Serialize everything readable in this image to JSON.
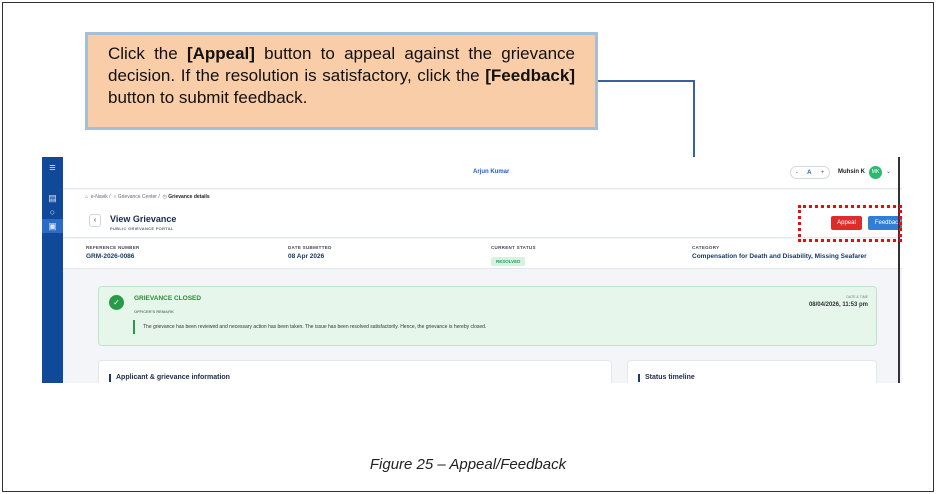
{
  "callout": {
    "part1": "Click the ",
    "appeal_bold": "[Appeal]",
    "part2": " button to appeal against the grievance decision. If the resolution is satisfactory, click the ",
    "feedback_bold": "[Feedback]",
    "part3": " button to submit feedback."
  },
  "topbar": {
    "center_name": "Arjun Kumar",
    "zoom_minus": "-",
    "zoom_a": "A",
    "zoom_plus": "+",
    "user_name": "Muhsin K",
    "avatar_initials": "MK"
  },
  "breadcrumb": {
    "home": "e-Navik",
    "sep1": "/",
    "center": "Grievance Center",
    "sep2": "/",
    "current": "Grievance details"
  },
  "header": {
    "title": "View Grievance",
    "subtitle": "PUBLIC GRIEVANCE PORTAL",
    "appeal_label": "Appeal",
    "feedback_label": "Feedback"
  },
  "meta": {
    "ref_key": "REFERENCE NUMBER",
    "ref_val": "GRM-2026-0086",
    "date_key": "DATE SUBMITTED",
    "date_val": "08 Apr 2026",
    "status_key": "CURRENT STATUS",
    "status_val": "RESOLVED",
    "cat_key": "CATEGORY",
    "cat_val": "Compensation for Death and Disability, Missing Seafarer"
  },
  "closed": {
    "title": "GRIEVANCE CLOSED",
    "remark_label": "OFFICER'S REMARK",
    "remark": "The grievance has been reviewed and necessary action has been taken. The issue has been resolved satisfactorily. Hence, the grievance is hereby closed.",
    "dt_label": "DATE & TIME",
    "dt_value": "08/04/2026, 11:53 pm"
  },
  "cards": {
    "applicant": "Applicant & grievance information",
    "timeline": "Status timeline"
  },
  "caption": "Figure 25 – Appeal/Feedback",
  "colors": {
    "appeal": "#dc2d2d",
    "feedback": "#2f7fd6",
    "sidebar": "#10499a",
    "callout_bg": "#f9cda8"
  }
}
